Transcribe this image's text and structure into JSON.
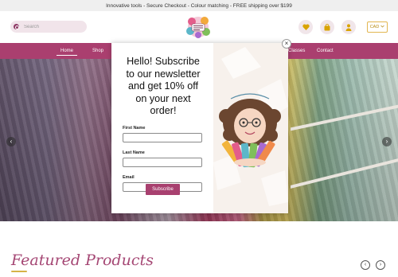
{
  "announcement": "Innovative tools - Secure Checkout - Colour matching - FREE shipping over $199",
  "header": {
    "search_placeholder": "Search",
    "currency": "CAD"
  },
  "nav": {
    "items": [
      "Home",
      "Shop",
      "Classes",
      "Contact"
    ]
  },
  "popup": {
    "title": "Hello! Subscribe to our newsletter and get 10% off on your next order!",
    "first_name_label": "First Name",
    "last_name_label": "Last Name",
    "email_label": "Email",
    "subscribe_label": "Subscribe",
    "close_symbol": "×"
  },
  "featured": {
    "title": "Featured Products"
  },
  "colors": {
    "brand": "#aa3f6f",
    "accent_gold": "#d9a300",
    "announcement_bg": "#efefef"
  },
  "icons": [
    "search-icon",
    "heart-icon",
    "bag-icon",
    "user-icon",
    "chevron-down-icon",
    "chevron-left-icon",
    "chevron-right-icon",
    "close-icon"
  ]
}
